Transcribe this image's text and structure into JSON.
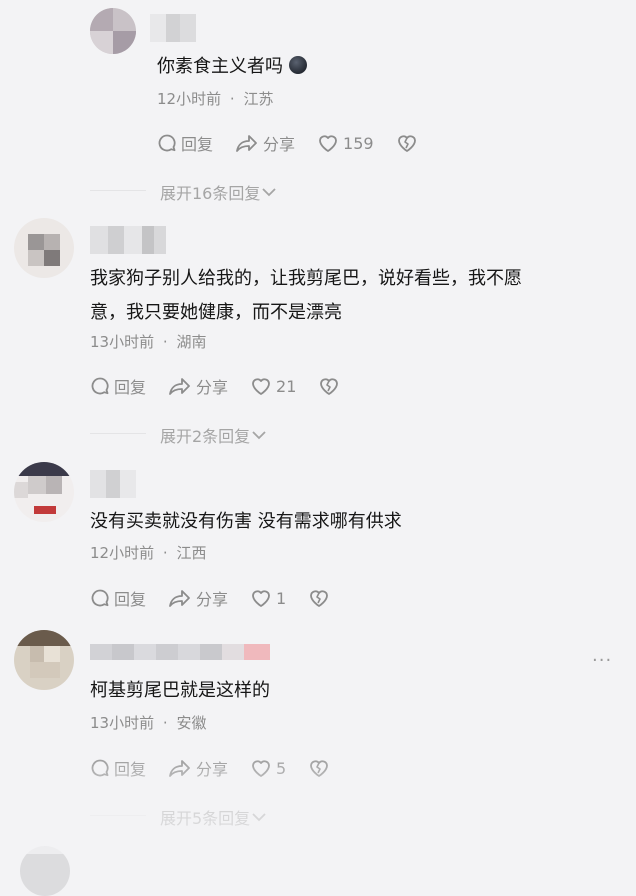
{
  "comments": [
    {
      "text": "你素食主义者吗",
      "emoji": "face-emoji",
      "time": "12小时前",
      "location": "江苏",
      "reply_label": "回复",
      "share_label": "分享",
      "likes": "159",
      "expand_label": "展开16条回复"
    },
    {
      "text_line1": "我家狗子别人给我的，让我剪尾巴，说好看些，我不愿",
      "text_line2": "意，我只要她健康，而不是漂亮",
      "time": "13小时前",
      "location": "湖南",
      "reply_label": "回复",
      "share_label": "分享",
      "likes": "21",
      "expand_label": "展开2条回复"
    },
    {
      "text": "没有买卖就没有伤害 没有需求哪有供求",
      "time": "12小时前",
      "location": "江西",
      "reply_label": "回复",
      "share_label": "分享",
      "likes": "1"
    },
    {
      "text": "柯基剪尾巴就是这样的",
      "time": "13小时前",
      "location": "安徽",
      "reply_label": "回复",
      "share_label": "分享",
      "likes": "5",
      "expand_label": "展开5条回复",
      "more_label": "···"
    }
  ],
  "meta_separator": "·",
  "colors": {
    "background": "#f3f3f5",
    "meta_text": "#8c8c8c",
    "expand_text": "#a5a5a5"
  },
  "icons": [
    "reply-icon",
    "share-icon",
    "like-icon",
    "dislike-icon",
    "chevron-down-icon"
  ]
}
